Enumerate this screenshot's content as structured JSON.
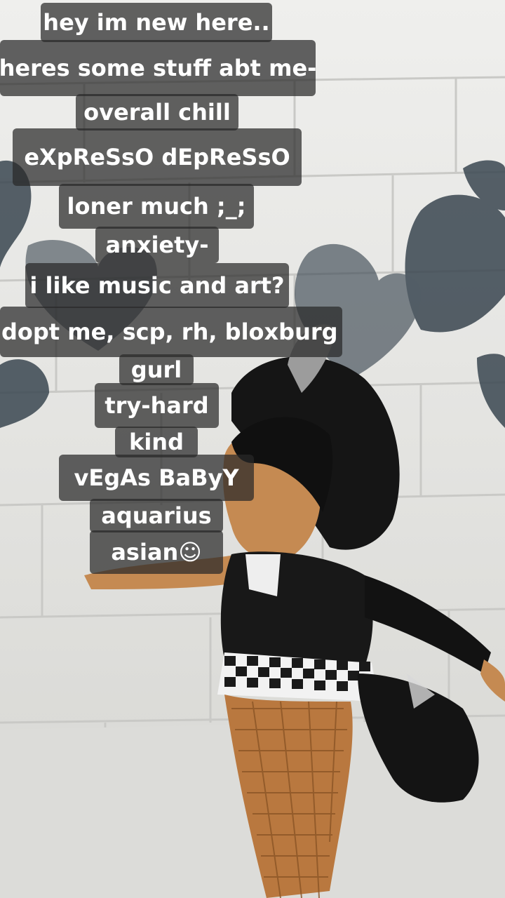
{
  "captions": [
    "hey im new here..",
    "heres some stuff abt me-",
    "overall chill",
    "eXpReSsO dEpReSsO",
    "loner much ;_;",
    "anxiety-",
    "i like music and art?",
    "dopt me, scp, rh, bloxburg",
    "gurl",
    "try-hard",
    "kind",
    "vEgAs BaByY",
    "aquarius",
    "asian☺"
  ],
  "colors": {
    "caption_bg": "#2a2a2a",
    "caption_text": "#ffffff",
    "wall": "#ececea",
    "avatar_hair": "#151515",
    "avatar_skin": "#c58a52"
  }
}
